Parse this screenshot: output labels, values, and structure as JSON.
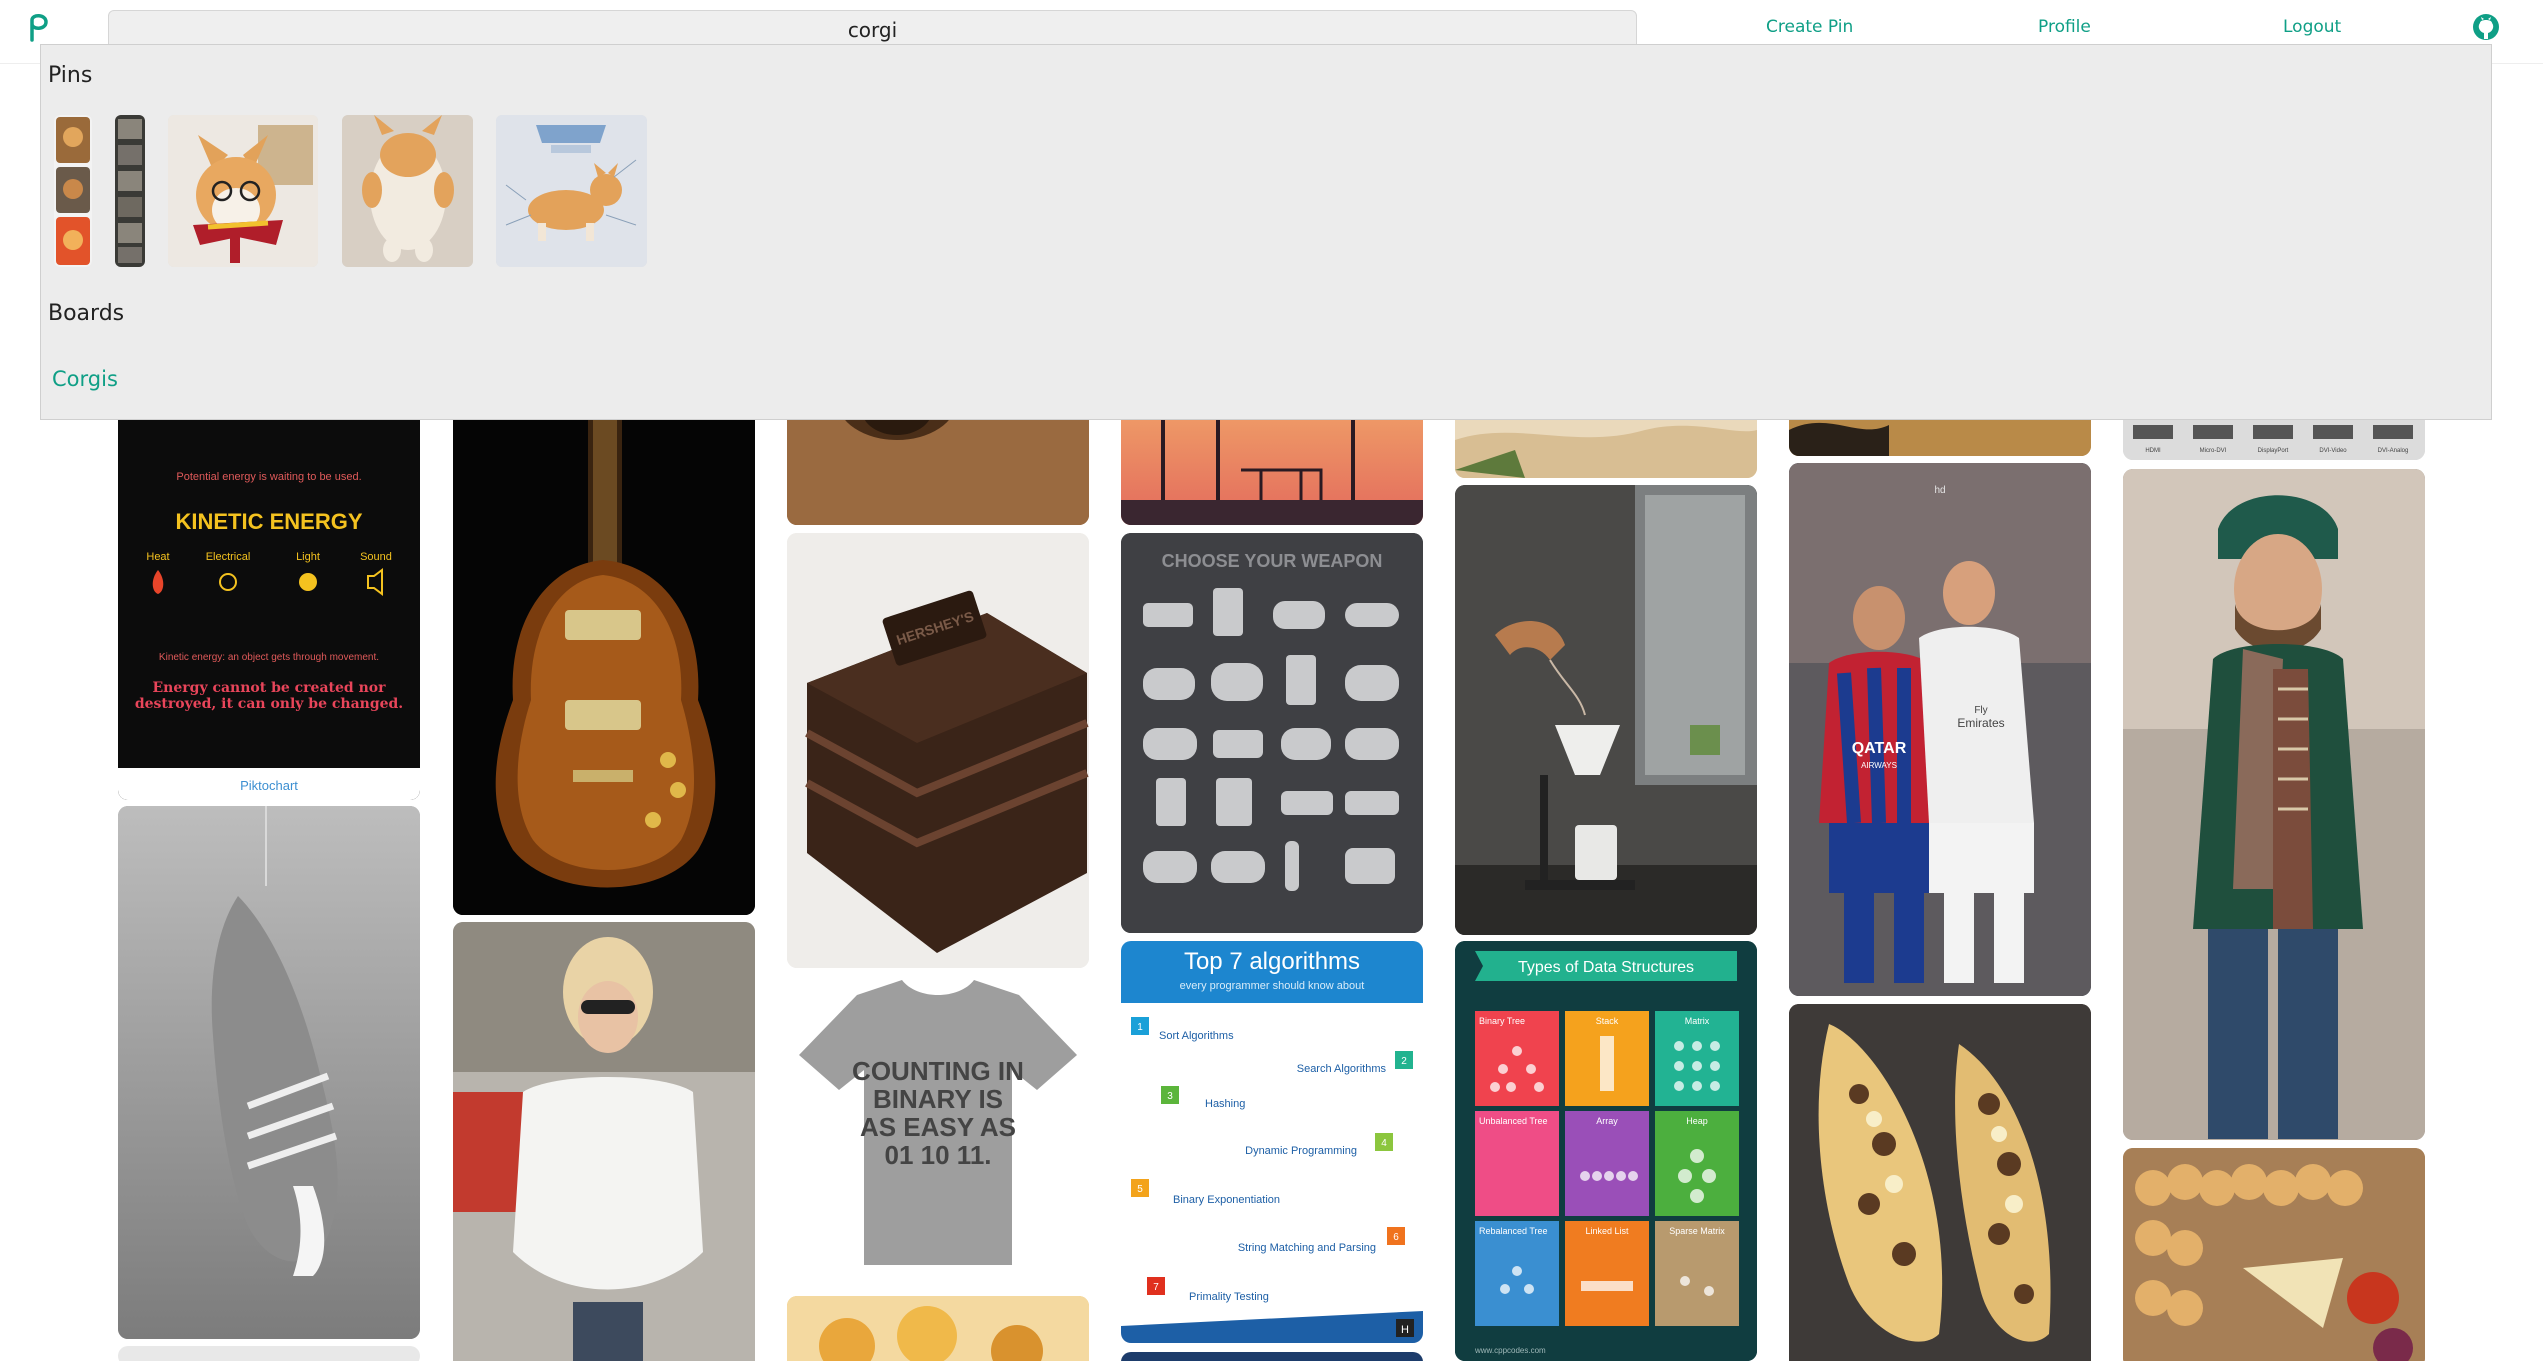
{
  "colors": {
    "accent": "#0f9f86",
    "dropdown_bg": "#ececec",
    "search_bg": "#efefef"
  },
  "nav": {
    "logo_icon": "p-logo-icon",
    "search_value": "corgi",
    "links": {
      "create_pin": "Create Pin",
      "profile": "Profile",
      "logout": "Logout"
    },
    "github_icon": "github-icon"
  },
  "dropdown": {
    "pins_title": "Pins",
    "boards_title": "Boards",
    "boards": [
      "Corgis"
    ]
  },
  "pins": {
    "physics": {
      "title": "KINETIC ENERGY",
      "line_top": "Potential energy is waiting to be used.",
      "labels": [
        "Heat",
        "Electrical",
        "Light",
        "Sound"
      ],
      "motion": "Kinetic energy: an object gets through movement.",
      "law": "Energy cannot be created nor destroyed, it can only be changed.",
      "credit": "Piktochart"
    },
    "cake_label": "HERSHEY'S",
    "weapon_title": "CHOOSE YOUR WEAPON",
    "tshirt_text": [
      "COUNTING IN",
      "BINARY IS",
      "AS EASY AS",
      "01 10 11."
    ],
    "algorithms": {
      "title": "Top 7 algorithms",
      "subtitle": "every programmer should know about",
      "items": [
        "Sort Algorithms",
        "Search Algorithms",
        "Hashing",
        "Dynamic Programming",
        "Binary Exponentiation",
        "String Matching and Parsing",
        "Primality Testing"
      ],
      "numbers": [
        "1",
        "2",
        "3",
        "4",
        "5",
        "6",
        "7"
      ],
      "badge": "H"
    },
    "data_structures": {
      "title": "Types of Data Structures",
      "cells": [
        "Binary Tree",
        "Stack",
        "Matrix",
        "Unbalanced Tree",
        "Array",
        "Heap",
        "Rebalanced Tree",
        "Linked List",
        "Sparse Matrix"
      ],
      "footer": "www.cppcodes.com"
    },
    "football": {
      "sponsor_a": "QATAR",
      "sponsor_a2": "AIRWAYS",
      "sponsor_b": "Fly",
      "sponsor_b2": "Emirates",
      "watermark": "hd"
    },
    "ports": [
      "HDMI",
      "Micro-DVI",
      "DisplayPort",
      "DVI-Video",
      "DVI-Analog"
    ]
  }
}
